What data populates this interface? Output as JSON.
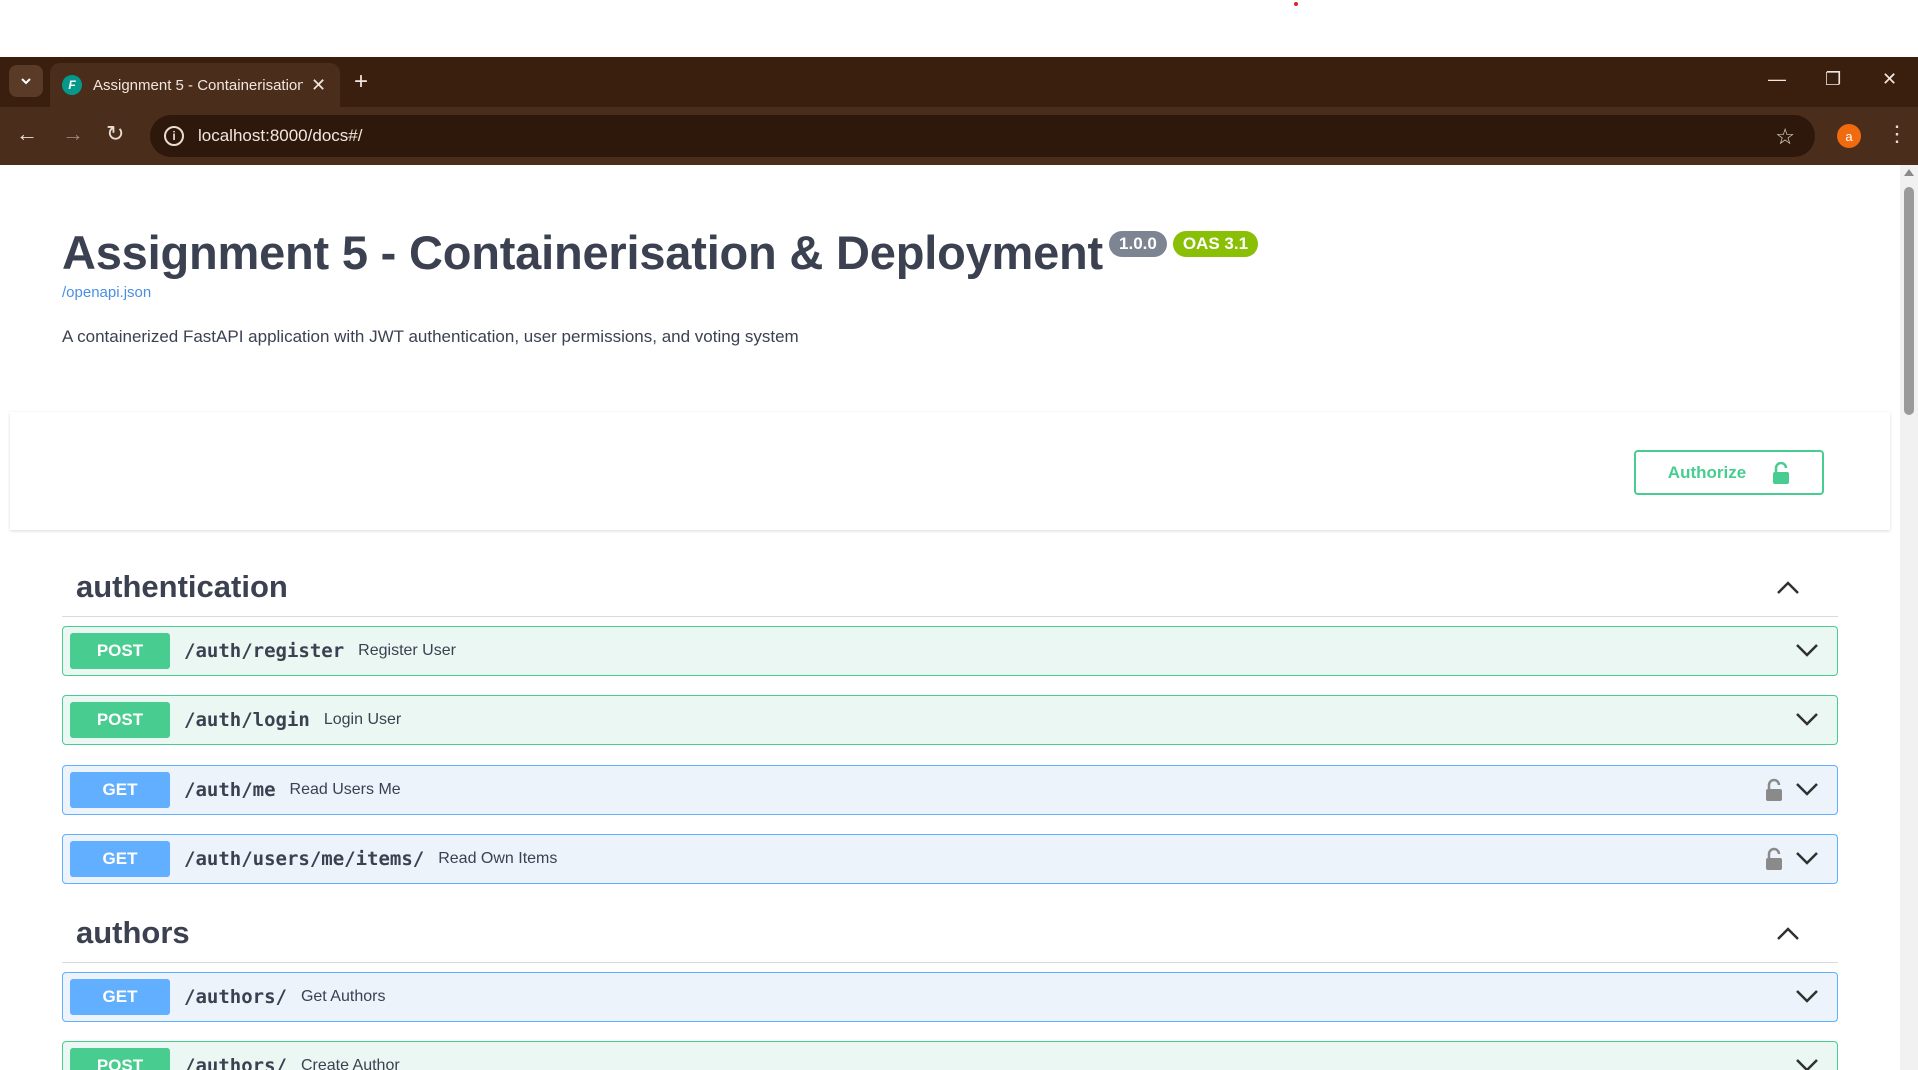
{
  "browser": {
    "tab_title": "Assignment 5 - Containerisation & Deployment",
    "favicon_letter": "F",
    "url": "localhost:8000/docs#/",
    "avatar_letter": "a"
  },
  "info": {
    "title": "Assignment 5 - Containerisation & Deployment",
    "version": "1.0.0",
    "oas": "OAS 3.1",
    "spec_link": "/openapi.json",
    "description": "A containerized FastAPI application with JWT authentication, user permissions, and voting system"
  },
  "authorize": {
    "label": "Authorize"
  },
  "tags": [
    {
      "name": "authentication",
      "operations": [
        {
          "method": "POST",
          "path": "/auth/register",
          "summary": "Register User"
        },
        {
          "method": "POST",
          "path": "/auth/login",
          "summary": "Login User"
        },
        {
          "method": "GET",
          "path": "/auth/me",
          "summary": "Read Users Me"
        },
        {
          "method": "GET",
          "path": "/auth/users/me/items/",
          "summary": "Read Own Items"
        }
      ]
    },
    {
      "name": "authors",
      "operations": [
        {
          "method": "GET",
          "path": "/authors/",
          "summary": "Get Authors"
        },
        {
          "method": "POST",
          "path": "/authors/",
          "summary": "Create Author"
        }
      ]
    }
  ],
  "colors": {
    "post": "#49cc90",
    "get": "#61affe",
    "titlebar": "#3a1f0e"
  }
}
